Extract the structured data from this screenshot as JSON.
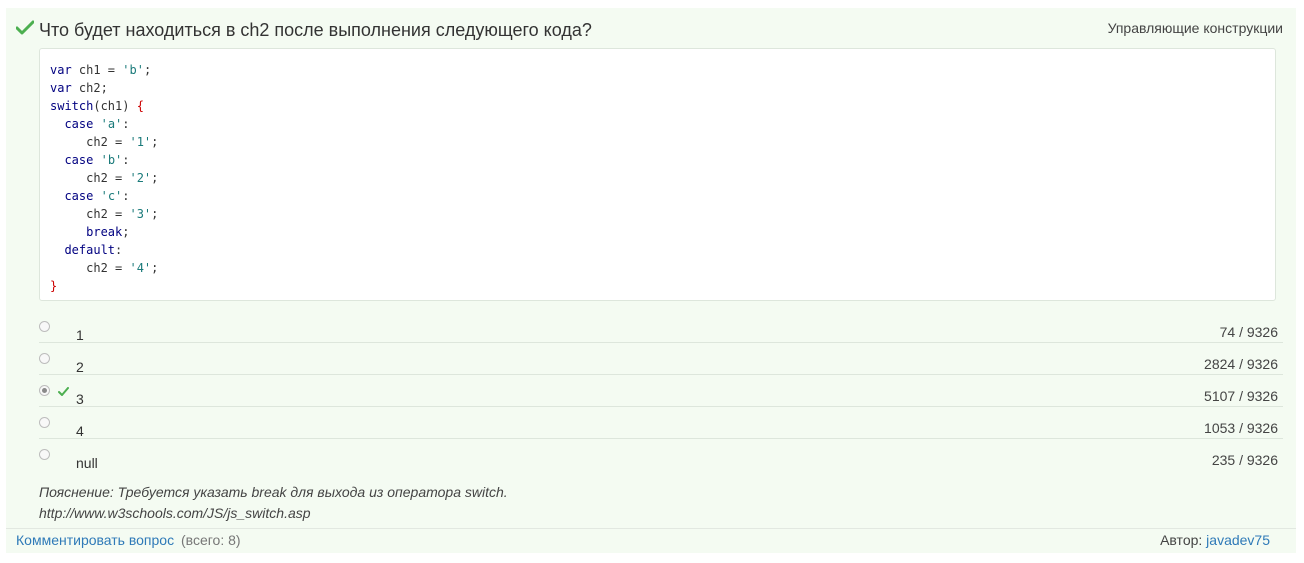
{
  "question": {
    "title": "Что будет находиться в ch2 после выполнения следующего кода?",
    "category": "Управляющие конструкции",
    "status_color": "#4caf50"
  },
  "code": [
    [
      {
        "t": "var",
        "c": "kw"
      },
      {
        "t": " ch1 = "
      },
      {
        "t": "'b'",
        "c": "str"
      },
      {
        "t": ";"
      }
    ],
    [
      {
        "t": "var",
        "c": "kw"
      },
      {
        "t": " ch2;"
      }
    ],
    [
      {
        "t": "switch",
        "c": "kw"
      },
      {
        "t": "(ch1) "
      },
      {
        "t": "{",
        "c": "brace"
      }
    ],
    [
      {
        "t": "  "
      },
      {
        "t": "case",
        "c": "kw"
      },
      {
        "t": " "
      },
      {
        "t": "'a'",
        "c": "str"
      },
      {
        "t": ":"
      }
    ],
    [
      {
        "t": "     ch2 = "
      },
      {
        "t": "'1'",
        "c": "str"
      },
      {
        "t": ";"
      }
    ],
    [
      {
        "t": "  "
      },
      {
        "t": "case",
        "c": "kw"
      },
      {
        "t": " "
      },
      {
        "t": "'b'",
        "c": "str"
      },
      {
        "t": ":"
      }
    ],
    [
      {
        "t": "     ch2 = "
      },
      {
        "t": "'2'",
        "c": "str"
      },
      {
        "t": ";"
      }
    ],
    [
      {
        "t": "  "
      },
      {
        "t": "case",
        "c": "kw"
      },
      {
        "t": " "
      },
      {
        "t": "'c'",
        "c": "str"
      },
      {
        "t": ":"
      }
    ],
    [
      {
        "t": "     ch2 = "
      },
      {
        "t": "'3'",
        "c": "str"
      },
      {
        "t": ";"
      }
    ],
    [
      {
        "t": "     "
      },
      {
        "t": "break",
        "c": "kw"
      },
      {
        "t": ";"
      }
    ],
    [
      {
        "t": "  "
      },
      {
        "t": "default",
        "c": "kw"
      },
      {
        "t": ":"
      }
    ],
    [
      {
        "t": "     ch2 = "
      },
      {
        "t": "'4'",
        "c": "str"
      },
      {
        "t": ";"
      }
    ],
    [
      {
        "t": "}",
        "c": "brace"
      }
    ]
  ],
  "answers": [
    {
      "label": "1",
      "count": "74 / 9326",
      "selected": false,
      "correct": false
    },
    {
      "label": "2",
      "count": "2824 / 9326",
      "selected": false,
      "correct": false
    },
    {
      "label": "3",
      "count": "5107 / 9326",
      "selected": true,
      "correct": true
    },
    {
      "label": "4",
      "count": "1053 / 9326",
      "selected": false,
      "correct": false
    },
    {
      "label": "null",
      "count": "235 / 9326",
      "selected": false,
      "correct": false
    }
  ],
  "explanation": {
    "line1": "Пояснение: Требуется указать break для выхода из оператора switch.",
    "line2": "http://www.w3schools.com/JS/js_switch.asp"
  },
  "footer": {
    "comment_label": "Комментировать вопрос",
    "comment_count": "(всего: 8)",
    "author_prefix": "Автор:",
    "author_name": "javadev75"
  }
}
